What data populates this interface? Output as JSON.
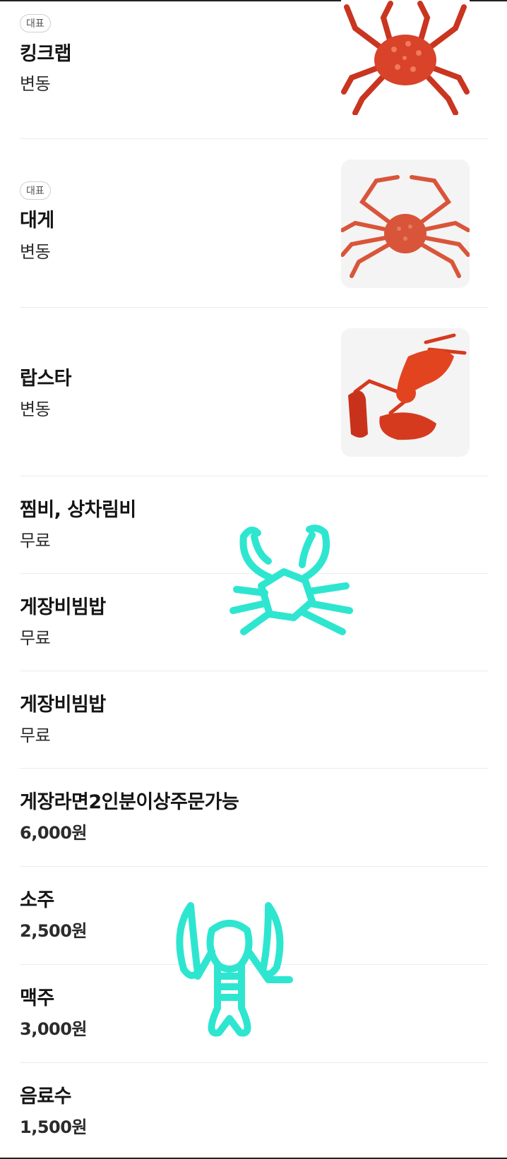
{
  "menu": {
    "items": [
      {
        "badge": "대표",
        "name": "킹크랩",
        "price": "변동",
        "image": "king-crab-photo"
      },
      {
        "badge": "대표",
        "name": "대게",
        "price": "변동",
        "image": "snow-crab-photo"
      },
      {
        "name": "랍스타",
        "price": "변동",
        "image": "lobster-photo"
      },
      {
        "name": "찜비, 상차림비",
        "price": "무료"
      },
      {
        "name": "게장비빔밥",
        "price": "무료"
      },
      {
        "name": "게장비빔밥",
        "price": "무료"
      },
      {
        "name": "게장라면2인분이상주문가능",
        "price": "6,000원"
      },
      {
        "name": "소주",
        "price": "2,500원"
      },
      {
        "name": "맥주",
        "price": "3,000원"
      },
      {
        "name": "음료수",
        "price": "1,500원"
      }
    ]
  },
  "doodles": {
    "color": "#2ee6d0",
    "shapes": [
      "crab-doodle",
      "lobster-doodle"
    ]
  },
  "colors": {
    "crab_red": "#d8432a",
    "divider": "#ececec",
    "badge_border": "#cfcfcf"
  }
}
